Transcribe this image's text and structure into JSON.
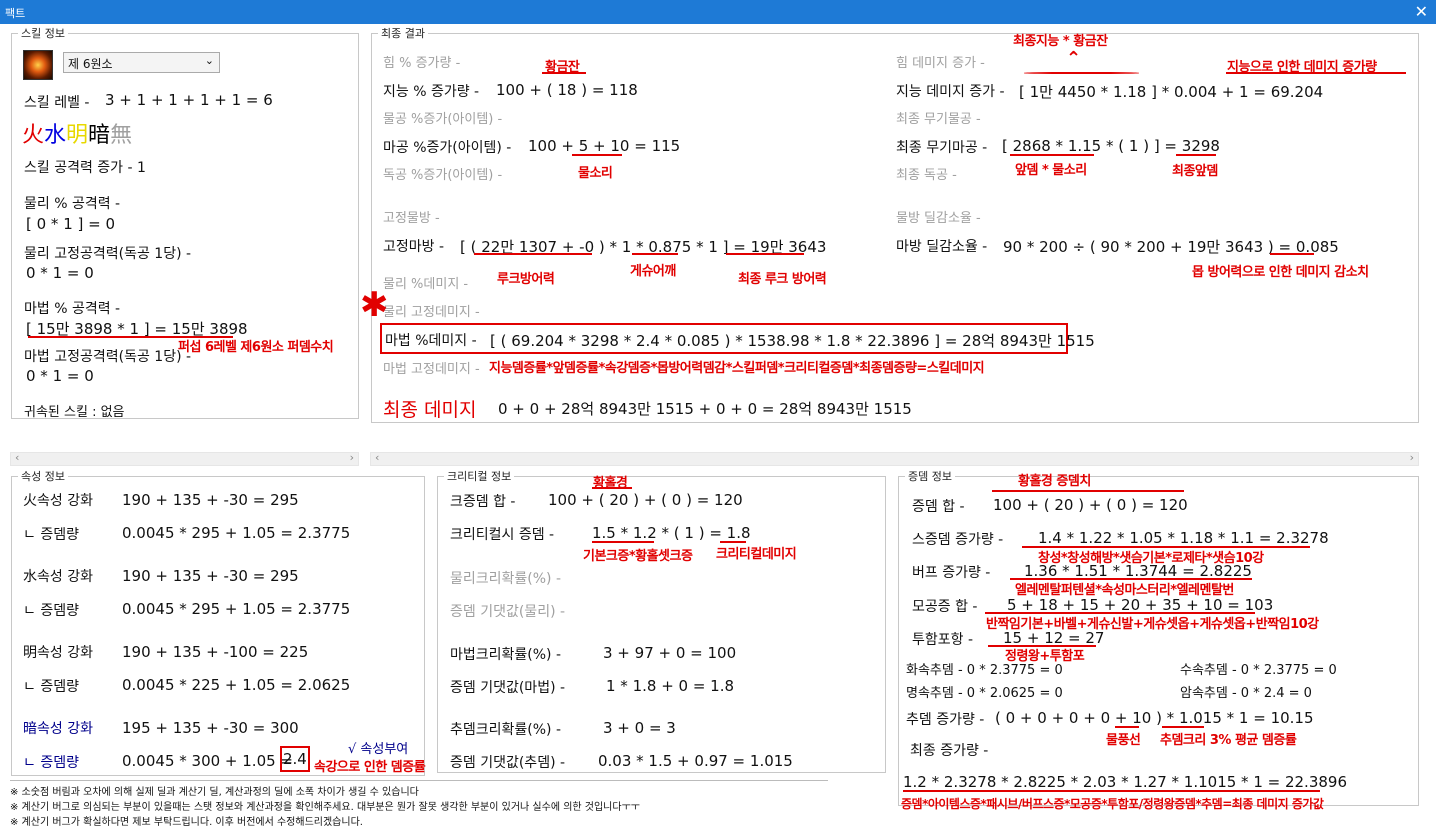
{
  "window": {
    "title": "팩트"
  },
  "skill": {
    "caption": "스킬 정보",
    "select": "제 6원소",
    "level_label": "스킬 레벨 -",
    "level_value": "3 + 1 + 1 + 1 + 1 = 6",
    "elements": [
      {
        "ch": "火",
        "color": "#e10000"
      },
      {
        "ch": "水",
        "color": "#0000e0"
      },
      {
        "ch": "明",
        "color": "#e8e800"
      },
      {
        "ch": "暗",
        "color": "#000000"
      },
      {
        "ch": "無",
        "color": "#a0a0a0"
      }
    ],
    "atk_inc": "스킬 공격력 증가 -   1",
    "phys_pct_label": "물리 % 공격력 -",
    "phys_pct_value": "[ 0 * 1 ] = 0",
    "phys_fixed_label": "물리 고정공격력(독공 1당) -",
    "phys_fixed_value": "0 * 1 = 0",
    "mag_pct_label": "마법 % 공격력 -",
    "mag_pct_value": "[ 15만 3898 * 1 ] = 15만 3898",
    "mag_fixed_label": "마법 고정공격력(독공 1당) -",
    "mag_fixed_value": "0 * 1 = 0",
    "bound_skill": "귀속된 스킬 : 없음",
    "ann_pasap": "퍼섭 6레벨 제6원소 퍼뎀수치"
  },
  "result": {
    "caption": "최종 결과",
    "str_pct": "힘 % 증가량 -",
    "int_pct_label": "지능 % 증가량 -",
    "int_pct_value": "100 + ( 18 ) = 118",
    "phys_item": "물공 %증가(아이템) -",
    "mag_item_label": "마공 %증가(아이템) -",
    "mag_item_value": "100 + 5 + 10 = 115",
    "ind_item": "독공 %증가(아이템) -",
    "fixed_phys": "고정물방 -",
    "fixed_mag_label": "고정마방 -",
    "fixed_mag_value": "[ ( 22만 1307 + -0 ) * 1 * 0.875 * 1 ] = 19만 3643",
    "phys_dmg_pct": "물리 %데미지 -",
    "phys_fixed_dmg": "물리 고정데미지 -",
    "mag_dmg_label": "마법 %데미지 -",
    "mag_dmg_value": "[ ( 69.204 * 3298 * 2.4 * 0.085 ) * 1538.98 * 1.8 * 22.3896 ] = 28억 8943만 1515",
    "mag_fixed_dmg": "마법 고정데미지 -",
    "str_dmg": "힘 데미지 증가 -",
    "int_dmg_label": "지능 데미지 증가 -",
    "int_dmg_value": "[ 1만 4450 * 1.18 ] * 0.004 + 1 = 69.204",
    "final_phys_weapon": "최종 무기물공 -",
    "final_mag_weapon_label": "최종 무기마공 -",
    "final_mag_weapon_value": "[ 2868 * 1.15 * ( 1 ) ] = 3298",
    "final_ind": "최종 독공 -",
    "phys_def_red": "물방 딜감소율 -",
    "mag_def_red_label": "마방 딜감소율 -",
    "mag_def_red_value": "90 * 200 ÷ ( 90 * 200 + 19만 3643 ) = 0.085",
    "final_label": "최종 데미지",
    "final_value": "0 + 0 + 28억 8943만 1515 + 0 + 0 = 28억 8943만 1515",
    "ann_hwanggeum": "황금잔",
    "ann_final_int": "최종지능 * 황금잔",
    "ann_int_dmg": "지능으로 인한 데미지 증가량",
    "ann_mulsori": "물소리",
    "ann_apdem": "앞뎀 * 물소리",
    "ann_final_apdem": "최종앞뎀",
    "ann_luk_def": "루크방어력",
    "ann_gesyu": "게슈어깨",
    "ann_final_luk": "최종 루크 방어력",
    "ann_mob_def": "몹 방어력으로 인한 데미지 감소치",
    "ann_formula": "지능뎀증률*앞뎀증률*속강뎀증*몹방어력뎀감*스킬퍼뎀*크리티컬증뎀*최종뎀증량=스킬데미지"
  },
  "attr": {
    "caption": "속성 정보",
    "rows": [
      {
        "label": "火속성 강화",
        "value": "190 + 135 + -30 = 295",
        "sub_label": "ㄴ 증뎀량",
        "sub_value": "0.0045 * 295 + 1.05 = 2.3775"
      },
      {
        "label": "水속성 강화",
        "value": "190 + 135 + -30 = 295",
        "sub_label": "ㄴ 증뎀량",
        "sub_value": "0.0045 * 295 + 1.05 = 2.3775"
      },
      {
        "label": "明속성 강화",
        "value": "190 + 135 + -100 = 225",
        "sub_label": "ㄴ 증뎀량",
        "sub_value": "0.0045 * 225 + 1.05 = 2.0625"
      },
      {
        "label": "暗속성 강화",
        "value": "195 + 135 + -30 = 300",
        "sub_label": "ㄴ 증뎀량",
        "sub_value": "0.0045 * 300 + 1.05 = "
      }
    ],
    "boxed_value": "2.4",
    "check": "√ 속성부여",
    "ann": "속강으로 인한 뎀증률"
  },
  "crit": {
    "caption": "크리티컬 정보",
    "sum_label": "크증뎀 합 -",
    "sum_value": "100 + ( 20 ) + ( 0 ) = 120",
    "crit_label": "크리티컬시 증뎀 -",
    "crit_value": "1.5 * 1.2 * ( 1 ) = 1.8",
    "phys_rate": "물리크리확률(%) -",
    "phys_exp": "증뎀 기댓값(물리) -",
    "mag_rate_label": "마법크리확률(%) -",
    "mag_rate_value": "3 + 97 + 0 = 100",
    "mag_exp_label": "증뎀 기댓값(마법) -",
    "mag_exp_value": "1 * 1.8 + 0 = 1.8",
    "add_rate_label": "추뎀크리확률(%) -",
    "add_rate_value": "3 + 0 = 3",
    "add_exp_label": "증뎀 기댓값(추뎀) -",
    "add_exp_value": "0.03 * 1.5 + 0.97 = 1.015",
    "ann_hwanhol": "황홀경",
    "ann_base": "기본크증*황홀셋크증",
    "ann_critdmg": "크리티컬데미지"
  },
  "boost": {
    "caption": "증뎀 정보",
    "sum_label": "증뎀 합 -",
    "sum_value": "100 + ( 20 ) + ( 0 ) = 120",
    "skill_label": "스증뎀 증가량 -",
    "skill_value": "1.4 * 1.22 * 1.05 * 1.18 * 1.1 = 2.3278",
    "buff_label": "버프 증가량 -",
    "buff_value": "1.36 * 1.51 * 1.3744 = 2.8225",
    "mogong_label": "모공증 합 -",
    "mogong_value": "5 + 18 + 15 + 20 + 35 + 10 = 103",
    "tuham_label": "투함포항 -",
    "tuham_value": "15 + 12 = 27",
    "fire_add": "화속추뎀 -   0 * 2.3775 = 0",
    "water_add": "수속추뎀 -   0 * 2.3775 = 0",
    "light_add": "명속추뎀 -   0 * 2.0625 = 0",
    "dark_add": "암속추뎀 -   0 * 2.4 = 0",
    "add_label": "추뎀 증가량 -",
    "add_value": "( 0 + 0 + 0 + 0 + 10 ) * 1.015 * 1 = 10.15",
    "final_label": "최종 증가량 -",
    "final_value": "1.2 * 2.3278 * 2.8225 * 2.03 * 1.27 * 1.1015 * 1 = 22.3896",
    "ann_title": "황홀경 증뎀치",
    "ann_skill": "창성*창성해방*샛슴기본*로제타*샛슴10강",
    "ann_buff": "엘레멘탈퍼텐셜*속성마스터리*엘레멘탈번",
    "ann_mogong": "반짝임기본+바벨+게슈신발+게슈셋옵+게슈셋옵+반짝임10강",
    "ann_tuham": "정령왕+투함포",
    "ann_mulpung": "물풍선",
    "ann_add_crit": "추뎀크리 3% 평균 뎀증률",
    "ann_final": "증뎀*아이템스증*패시브/버프스증*모공증*투함포/정령왕증뎀*추뎀=최종 데미지 증가값"
  },
  "notes": [
    "※ 소숫점 버림과 오차에 의해 실제 딜과 계산기 딜, 계산과정의 딜에 소폭 차이가 생길 수 있습니다",
    "※ 계산기 버그로 의심되는 부분이 있을때는 스탯 정보와 계산과정을 확인해주세요. 대부분은 뭔가 잘못 생각한 부분이 있거나 실수에 의한 것입니다ㅜㅜ",
    "※ 계산기 버그가 확실하다면 제보 부탁드립니다. 이후 버전에서 수정해드리겠습니다."
  ]
}
